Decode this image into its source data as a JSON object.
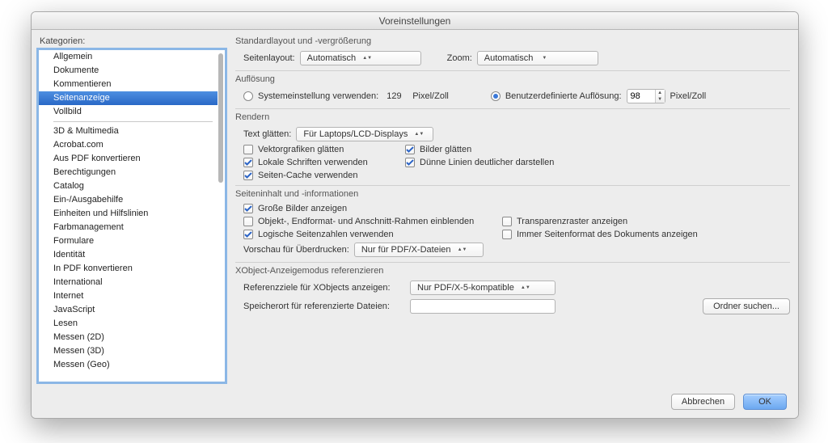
{
  "window": {
    "title": "Voreinstellungen"
  },
  "sidebar": {
    "label": "Kategorien:",
    "primary": [
      {
        "label": "Allgemein"
      },
      {
        "label": "Dokumente"
      },
      {
        "label": "Kommentieren"
      },
      {
        "label": "Seitenanzeige",
        "selected": true
      },
      {
        "label": "Vollbild"
      }
    ],
    "secondary": [
      {
        "label": "3D & Multimedia"
      },
      {
        "label": "Acrobat.com"
      },
      {
        "label": "Aus PDF konvertieren"
      },
      {
        "label": "Berechtigungen"
      },
      {
        "label": "Catalog"
      },
      {
        "label": "Ein-/Ausgabehilfe"
      },
      {
        "label": "Einheiten und Hilfslinien"
      },
      {
        "label": "Farbmanagement"
      },
      {
        "label": "Formulare"
      },
      {
        "label": "Identität"
      },
      {
        "label": "In PDF konvertieren"
      },
      {
        "label": "International"
      },
      {
        "label": "Internet"
      },
      {
        "label": "JavaScript"
      },
      {
        "label": "Lesen"
      },
      {
        "label": "Messen (2D)"
      },
      {
        "label": "Messen (3D)"
      },
      {
        "label": "Messen (Geo)"
      }
    ]
  },
  "layout": {
    "title": "Standardlayout und -vergrößerung",
    "seitenlayout_label": "Seitenlayout:",
    "seitenlayout_value": "Automatisch",
    "zoom_label": "Zoom:",
    "zoom_value": "Automatisch"
  },
  "resolution": {
    "title": "Auflösung",
    "system_label": "Systemeinstellung verwenden:",
    "system_value": "129",
    "unit": "Pixel/Zoll",
    "custom_label": "Benutzerdefinierte Auflösung:",
    "custom_value": "98"
  },
  "render": {
    "title": "Rendern",
    "text_smoothing_label": "Text glätten:",
    "text_smoothing_value": "Für Laptops/LCD-Displays",
    "vector": "Vektorgrafiken glätten",
    "images": "Bilder glätten",
    "localfonts": "Lokale Schriften verwenden",
    "thinlines": "Dünne Linien deutlicher darstellen",
    "pagecache": "Seiten-Cache verwenden"
  },
  "content_info": {
    "title": "Seiteninhalt und -informationen",
    "large_images": "Große Bilder anzeigen",
    "frames": "Objekt-, Endformat- und Anschnitt-Rahmen einblenden",
    "transparency": "Transparenzraster anzeigen",
    "logical_pages": "Logische Seitenzahlen verwenden",
    "always_format": "Immer Seitenformat des Dokuments anzeigen",
    "overprint_label": "Vorschau für Überdrucken:",
    "overprint_value": "Nur für PDF/X-Dateien"
  },
  "xobject": {
    "title": "XObject-Anzeigemodus referenzieren",
    "targets_label": "Referenzziele für XObjects anzeigen:",
    "targets_value": "Nur PDF/X-5-kompatible",
    "location_label": "Speicherort für referenzierte Dateien:",
    "browse": "Ordner suchen..."
  },
  "buttons": {
    "cancel": "Abbrechen",
    "ok": "OK"
  }
}
